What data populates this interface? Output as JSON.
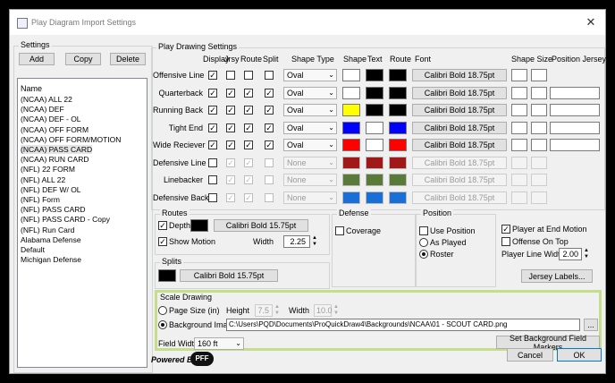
{
  "window": {
    "title": "Play Diagram Import Settings",
    "close": "✕"
  },
  "settings": {
    "group_title": "Settings",
    "add": "Add",
    "copy": "Copy",
    "delete": "Delete",
    "list_header": "Name",
    "items": [
      "(NCAA) ALL 22",
      "(NCAA) DEF",
      "(NCAA) DEF - OL",
      "(NCAA) OFF FORM",
      "(NCAA) OFF FORM/MOTION",
      "(NCAA) PASS CARD",
      "(NCAA) RUN CARD",
      "(NFL) 22 FORM",
      "(NFL) ALL 22",
      "(NFL) DEF W/ OL",
      "(NFL) Form",
      "(NFL) PASS CARD",
      "(NFL) PASS CARD - Copy",
      "(NFL) Run Card",
      "Alabama Defense",
      "Default",
      "Michigan Defense"
    ],
    "selected_index": 5
  },
  "drawing": {
    "group_title": "Play Drawing Settings",
    "headers": {
      "display": "Display",
      "jrsy": "Jrsy",
      "route": "Route",
      "split": "Split",
      "shape_type": "Shape Type",
      "shape": "Shape",
      "text": "Text",
      "route_color": "Route",
      "font": "Font",
      "shape_size": "Shape Size",
      "position_jerseys": "Position Jerseys"
    },
    "rows": [
      {
        "label": "Offensive Line",
        "display": "✓",
        "jrsy": "",
        "route": "",
        "split": "",
        "shape_type": "Oval",
        "shape": "#ffffff",
        "text": "#000000",
        "route_color": "#000000",
        "font": "Calibri Bold 18.75pt",
        "enabled": true,
        "extra": false
      },
      {
        "label": "Quarterback",
        "display": "✓",
        "jrsy": "✓",
        "route": "✓",
        "split": "✓",
        "shape_type": "Oval",
        "shape": "#ffffff",
        "text": "#000000",
        "route_color": "#000000",
        "font": "Calibri Bold 18.75pt",
        "enabled": true,
        "extra": true
      },
      {
        "label": "Running Back",
        "display": "✓",
        "jrsy": "✓",
        "route": "✓",
        "split": "✓",
        "shape_type": "Oval",
        "shape": "#ffff00",
        "text": "#000000",
        "route_color": "#000000",
        "font": "Calibri Bold 18.75pt",
        "enabled": true,
        "extra": true
      },
      {
        "label": "Tight End",
        "display": "✓",
        "jrsy": "✓",
        "route": "✓",
        "split": "✓",
        "shape_type": "Oval",
        "shape": "#0000ff",
        "text": "#ffffff",
        "route_color": "#0000ff",
        "font": "Calibri Bold 18.75pt",
        "enabled": true,
        "extra": true
      },
      {
        "label": "Wide Reciever",
        "display": "✓",
        "jrsy": "✓",
        "route": "✓",
        "split": "✓",
        "shape_type": "Oval",
        "shape": "#ff0000",
        "text": "#ffffff",
        "route_color": "#ff0000",
        "font": "Calibri Bold 18.75pt",
        "enabled": true,
        "extra": true
      },
      {
        "label": "Defensive Line",
        "display": "",
        "jrsy": "✓",
        "route": "✓",
        "split": "",
        "shape_type": "None",
        "shape": "#a01818",
        "text": "#a01818",
        "route_color": "#a01818",
        "font": "Calibri Bold 18.75pt",
        "enabled": false,
        "extra": false
      },
      {
        "label": "Linebacker",
        "display": "",
        "jrsy": "✓",
        "route": "✓",
        "split": "",
        "shape_type": "None",
        "shape": "#5a7a3a",
        "text": "#5a7a3a",
        "route_color": "#5a7a3a",
        "font": "Calibri Bold 18.75pt",
        "enabled": false,
        "extra": false
      },
      {
        "label": "Defensive Back",
        "display": "",
        "jrsy": "✓",
        "route": "✓",
        "split": "",
        "shape_type": "None",
        "shape": "#1a6fd6",
        "text": "#1a6fd6",
        "route_color": "#1a6fd6",
        "font": "Calibri Bold 18.75pt",
        "enabled": false,
        "extra": false
      }
    ]
  },
  "routes": {
    "group_title": "Routes",
    "depth": "Depth",
    "depth_checked": "✓",
    "font": "Calibri Bold 15.75pt",
    "show_motion": "Show Motion",
    "show_motion_checked": "✓",
    "width_label": "Width",
    "width_value": "2.25"
  },
  "splits": {
    "group_title": "Splits",
    "font": "Calibri Bold 15.75pt"
  },
  "defense": {
    "group_title": "Defense",
    "coverage": "Coverage"
  },
  "position": {
    "group_title": "Position",
    "use_position": "Use Position",
    "as_played": "As Played",
    "roster": "Roster"
  },
  "right": {
    "player_end_motion": "Player at End Motion",
    "player_end_motion_checked": "✓",
    "offense_on_top": "Offense On Top",
    "player_line_width": "Player Line Width",
    "line_width_value": "2.00",
    "jersey_labels": "Jersey Labels..."
  },
  "scale": {
    "group_title": "Scale Drawing",
    "page_size": "Page Size (in)",
    "height_label": "Height",
    "height_value": "7.5",
    "width_label": "Width",
    "width_value": "10.0",
    "background_image": "Background Image",
    "path": "C:\\Users\\PQD\\Documents\\ProQuickDraw4\\Backgrounds\\NCAA\\01 - SCOUT CARD.png",
    "browse": "...",
    "field_width_label": "Field Width",
    "field_width_value": "160 ft",
    "set_markers": "Set Background Field Markers"
  },
  "footer": {
    "powered_by": "Powered By",
    "brand": "PFF",
    "cancel": "Cancel",
    "ok": "OK"
  }
}
